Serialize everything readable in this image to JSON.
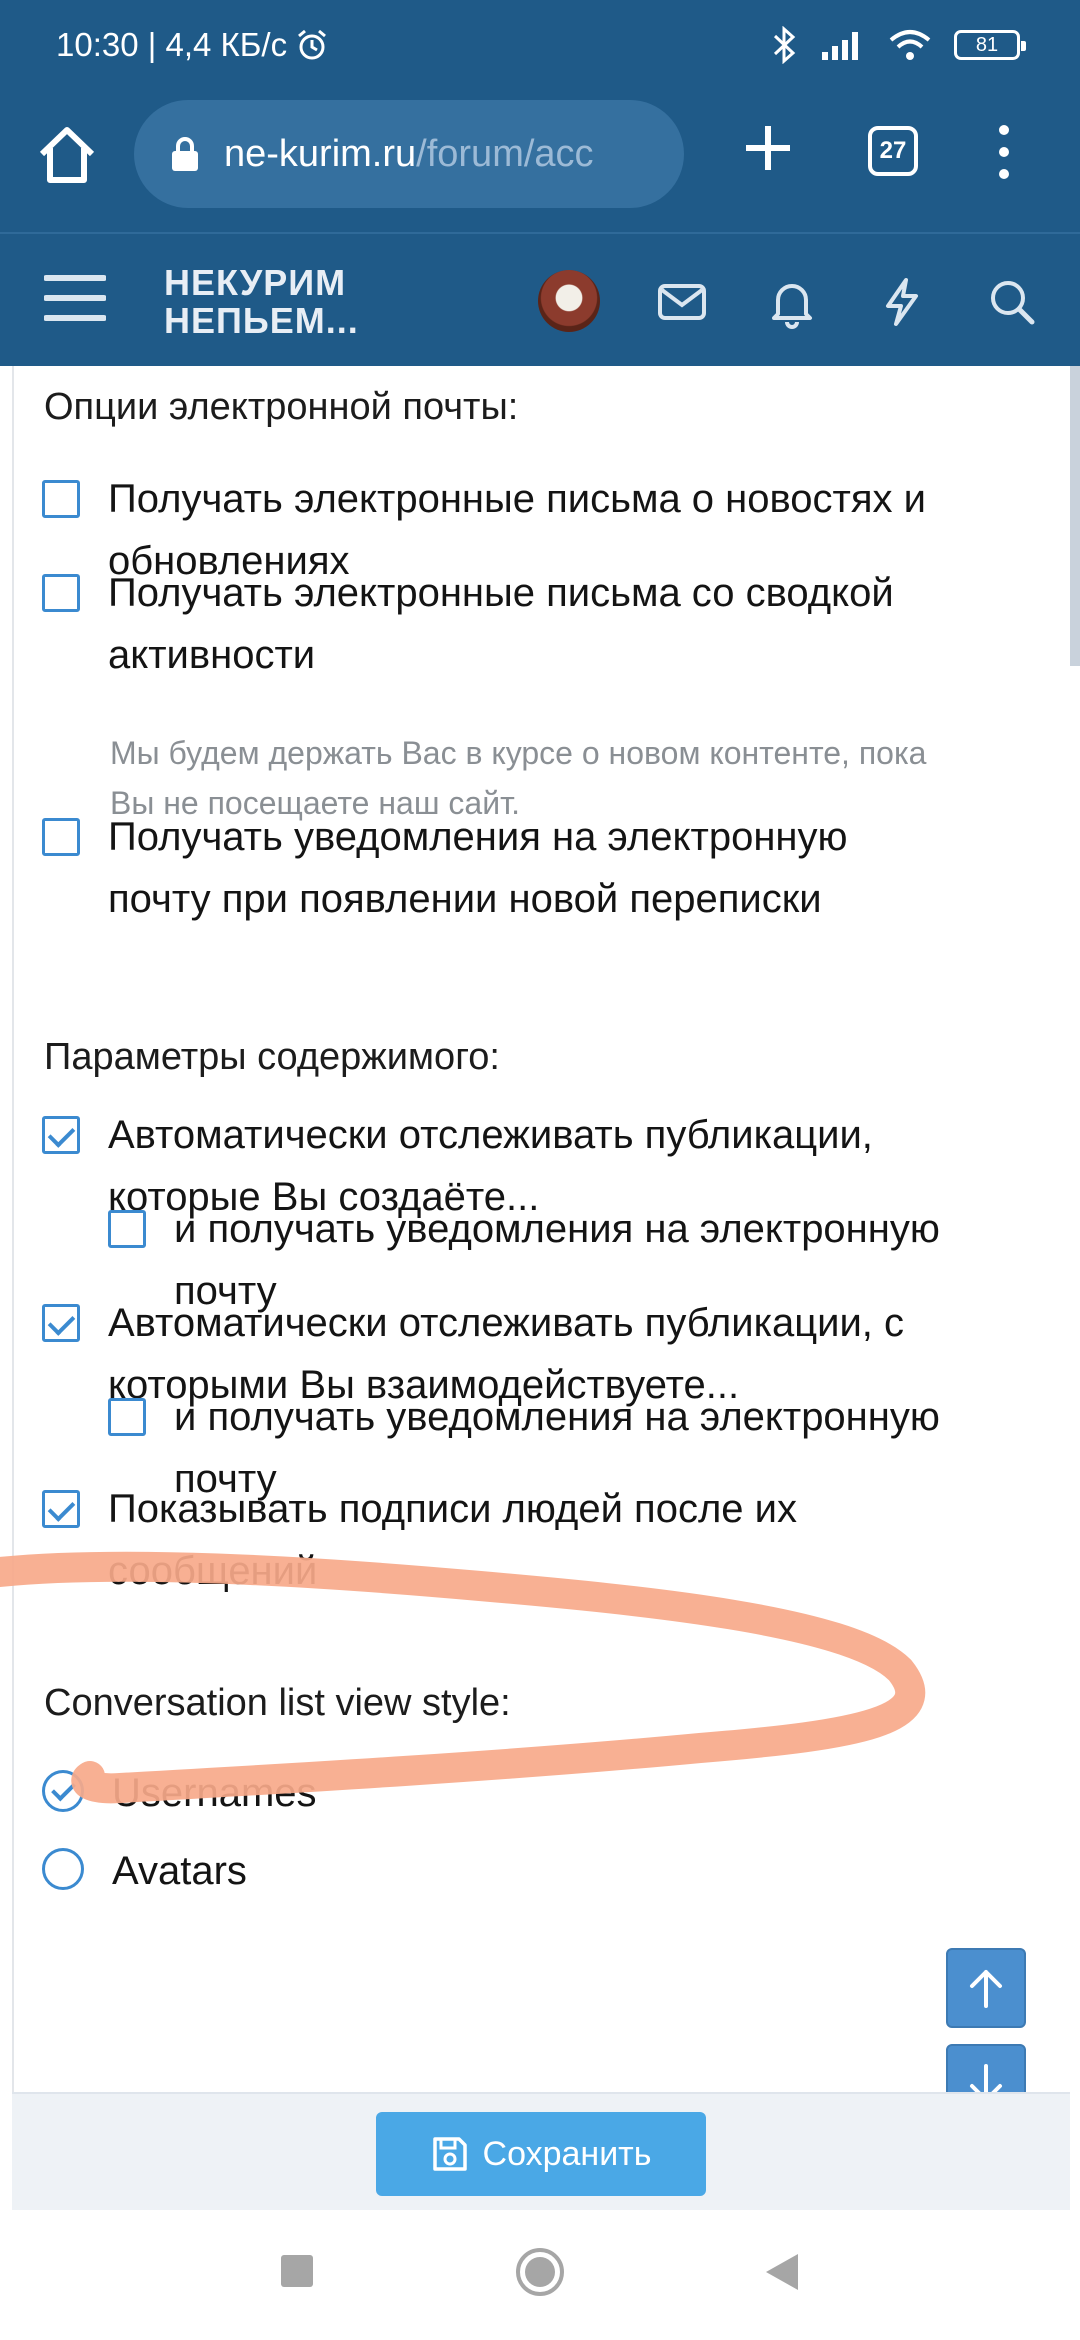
{
  "status_bar": {
    "time_speed": "10:30 | 4,4 КБ/с",
    "battery": "81"
  },
  "browser": {
    "url_domain": "ne-kurim.ru",
    "url_path": "/forum/acc",
    "tab_count": "27"
  },
  "site": {
    "logo_line1": "НЕКУРИМ",
    "logo_line2": "НЕПЬЕМ..."
  },
  "email_section": {
    "title": "Опции электронной почты:",
    "options": [
      {
        "label_l1": "Получать электронные письма о новостях и",
        "label_l2": "обновлениях",
        "checked": false
      },
      {
        "label_l1": "Получать электронные письма со сводкой",
        "label_l2": "активности",
        "checked": false,
        "hint_l1": "Мы будем держать Вас в курсе о новом контенте, пока",
        "hint_l2": "Вы не посещаете наш сайт."
      },
      {
        "label_l1": "Получать уведомления на электронную",
        "label_l2": "почту при появлении новой переписки",
        "checked": false
      }
    ]
  },
  "content_section": {
    "title": "Параметры содержимого:",
    "options": [
      {
        "label_l1": "Автоматически отслеживать публикации,",
        "label_l2": "которые Вы создаёте...",
        "checked": true
      },
      {
        "label_l1": "и получать уведомления на электронную",
        "label_l2": "почту",
        "checked": false
      },
      {
        "label_l1": "Автоматически отслеживать публикации, с",
        "label_l2": "которыми Вы взаимодействуете...",
        "checked": true
      },
      {
        "label_l1": "и получать уведомления на электронную",
        "label_l2": "почту",
        "checked": false
      },
      {
        "label_l1": "Показывать подписи людей после их",
        "label_l2": "сообщений",
        "checked": true
      }
    ]
  },
  "conversation_section": {
    "title": "Conversation list view style:",
    "options": [
      {
        "label": "Usernames",
        "selected": true
      },
      {
        "label": "Avatars",
        "selected": false
      }
    ]
  },
  "footer": {
    "save_label": "Сохранить"
  },
  "colors": {
    "header": "#1f5a88",
    "accent": "#3b8ad0",
    "annotation": "#f7a98a"
  }
}
